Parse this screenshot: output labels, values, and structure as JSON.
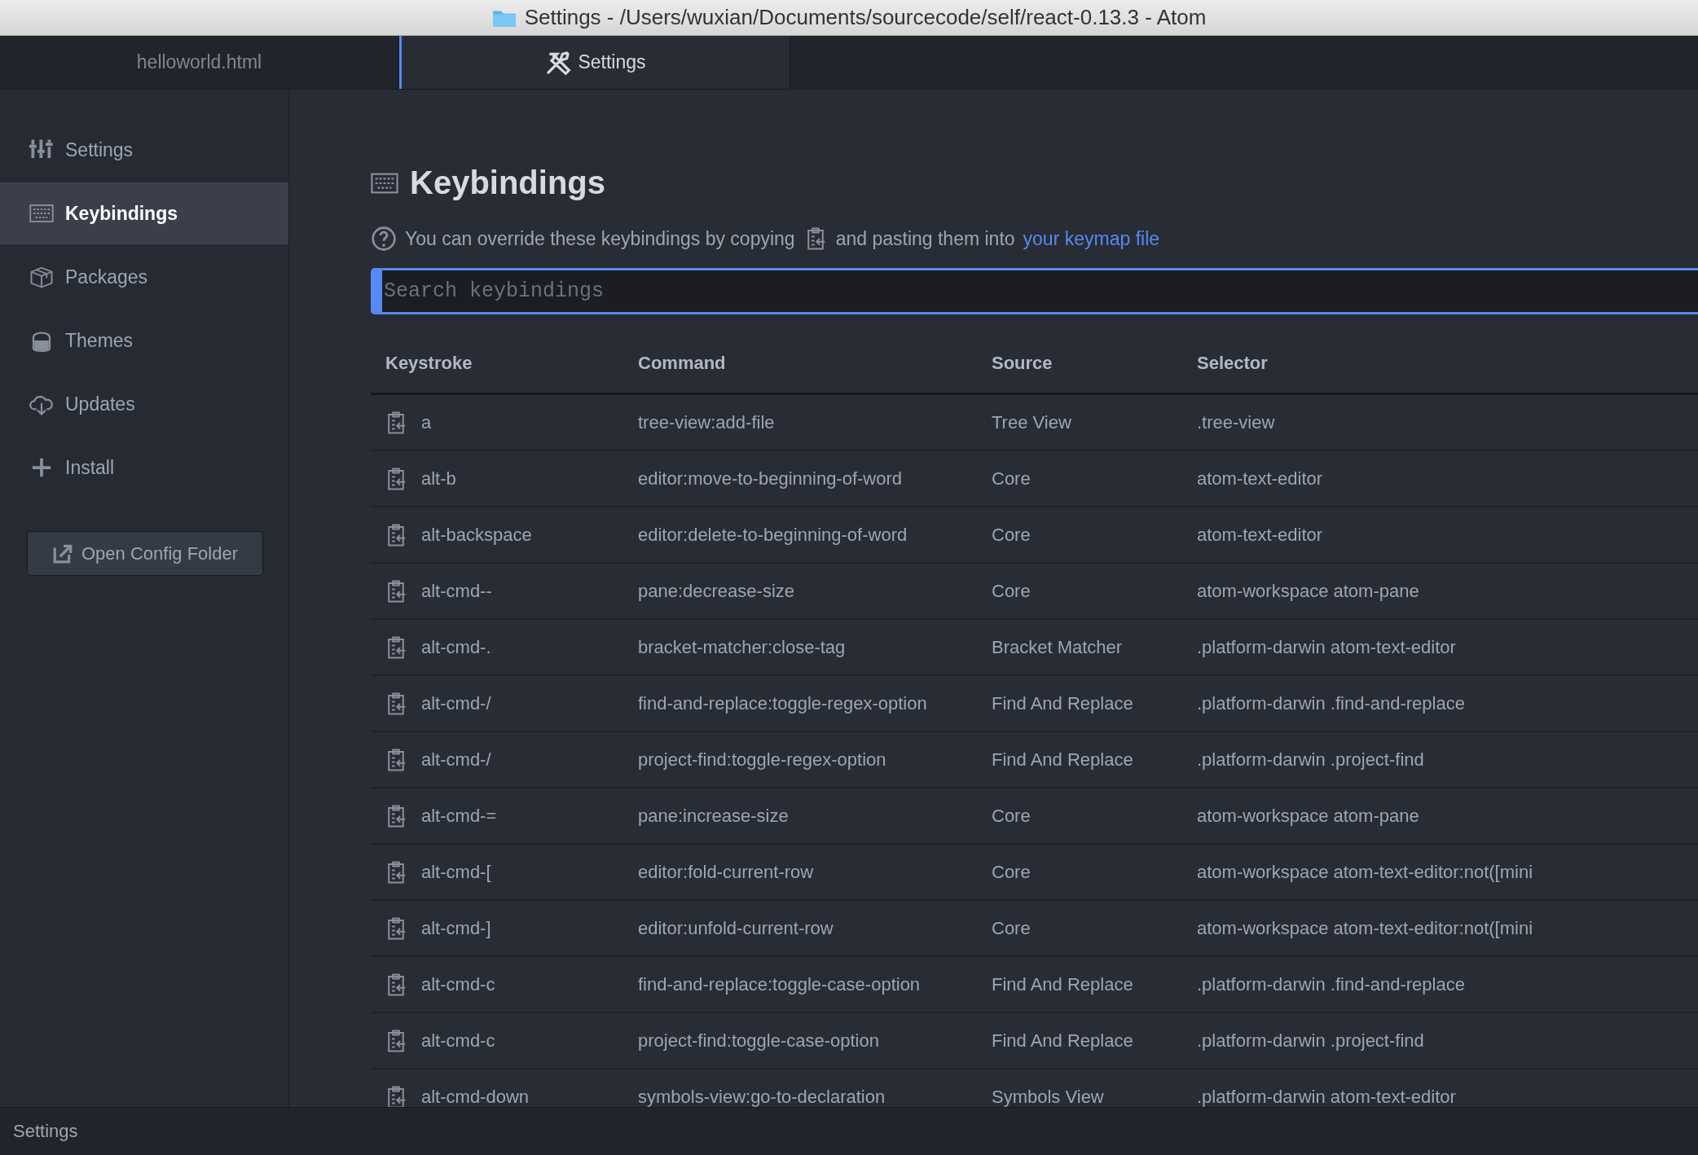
{
  "window": {
    "title": "Settings - /Users/wuxian/Documents/sourcecode/self/react-0.13.3 - Atom"
  },
  "tabs": [
    {
      "label": "helloworld.html",
      "selected": false
    },
    {
      "label": "Settings",
      "selected": true
    }
  ],
  "sidebar": {
    "items": [
      {
        "label": "Settings",
        "selected": false
      },
      {
        "label": "Keybindings",
        "selected": true
      },
      {
        "label": "Packages",
        "selected": false
      },
      {
        "label": "Themes",
        "selected": false
      },
      {
        "label": "Updates",
        "selected": false
      },
      {
        "label": "Install",
        "selected": false
      }
    ],
    "button": "Open Config Folder"
  },
  "panel": {
    "heading": "Keybindings",
    "info_before": "You can override these keybindings by copying",
    "info_after": "and pasting them into",
    "info_link": "your keymap file",
    "search": {
      "placeholder": "Search keybindings"
    }
  },
  "table": {
    "columns": [
      "Keystroke",
      "Command",
      "Source",
      "Selector"
    ],
    "rows": [
      [
        "a",
        "tree-view:add-file",
        "Tree View",
        ".tree-view"
      ],
      [
        "alt-b",
        "editor:move-to-beginning-of-word",
        "Core",
        "atom-text-editor"
      ],
      [
        "alt-backspace",
        "editor:delete-to-beginning-of-word",
        "Core",
        "atom-text-editor"
      ],
      [
        "alt-cmd--",
        "pane:decrease-size",
        "Core",
        "atom-workspace atom-pane"
      ],
      [
        "alt-cmd-.",
        "bracket-matcher:close-tag",
        "Bracket Matcher",
        ".platform-darwin atom-text-editor"
      ],
      [
        "alt-cmd-/",
        "find-and-replace:toggle-regex-option",
        "Find And Replace",
        ".platform-darwin .find-and-replace"
      ],
      [
        "alt-cmd-/",
        "project-find:toggle-regex-option",
        "Find And Replace",
        ".platform-darwin .project-find"
      ],
      [
        "alt-cmd-=",
        "pane:increase-size",
        "Core",
        "atom-workspace atom-pane"
      ],
      [
        "alt-cmd-[",
        "editor:fold-current-row",
        "Core",
        "atom-workspace atom-text-editor:not([mini"
      ],
      [
        "alt-cmd-]",
        "editor:unfold-current-row",
        "Core",
        "atom-workspace atom-text-editor:not([mini"
      ],
      [
        "alt-cmd-c",
        "find-and-replace:toggle-case-option",
        "Find And Replace",
        ".platform-darwin .find-and-replace"
      ],
      [
        "alt-cmd-c",
        "project-find:toggle-case-option",
        "Find And Replace",
        ".platform-darwin .project-find"
      ],
      [
        "alt-cmd-down",
        "symbols-view:go-to-declaration",
        "Symbols View",
        ".platform-darwin atom-text-editor"
      ]
    ]
  },
  "status_bar": {
    "text": "Settings"
  }
}
